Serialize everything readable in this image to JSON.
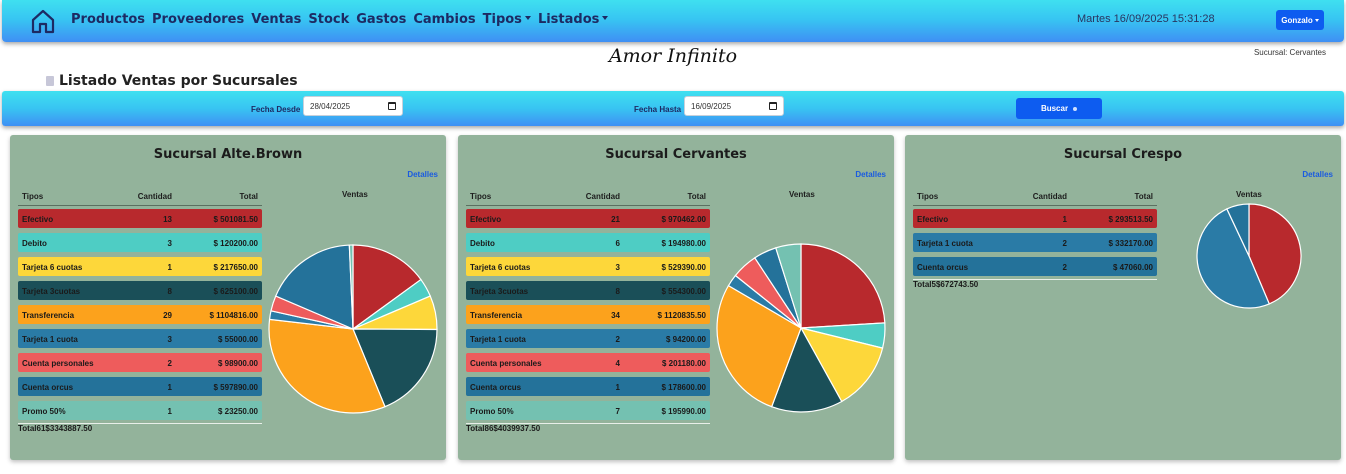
{
  "navbar": {
    "menu": [
      {
        "label": "Productos",
        "dropdown": false
      },
      {
        "label": "Proveedores",
        "dropdown": false
      },
      {
        "label": "Ventas",
        "dropdown": false
      },
      {
        "label": "Stock",
        "dropdown": false
      },
      {
        "label": "Gastos",
        "dropdown": false
      },
      {
        "label": "Cambios",
        "dropdown": false
      },
      {
        "label": "Tipos",
        "dropdown": true
      },
      {
        "label": "Listados",
        "dropdown": true
      }
    ],
    "datetime": "Martes 16/09/2025 15:31:28",
    "user": "Gonzalo",
    "icon": "home-icon"
  },
  "brand": "Amor Infinito",
  "branch_label": "Sucursal: Cervantes",
  "page_title": "Listado Ventas por Sucursales",
  "filters": {
    "desde_label": "Fecha Desde",
    "desde_value": "28/04/2025",
    "hasta_label": "Fecha Hasta",
    "hasta_value": "16/09/2025",
    "search_label": "Buscar"
  },
  "colors": {
    "Efectivo": "#b8292d",
    "Debito": "#4ecdc4",
    "Tarjeta 6 cuotas": "#fdd73a",
    "Tarjeta 3cuotas": "#1a4f58",
    "Transferencia": "#fca21c",
    "Tarjeta 1 cuota": "#2a7ba6",
    "Cuenta personales": "#ee5c5c",
    "Cuenta orcus": "#24729a",
    "Promo 50%": "#74c1b1"
  },
  "branches": [
    {
      "title": "Sucursal Alte.Brown",
      "details_label": "Detalles",
      "headers": {
        "tipo": "Tipos",
        "cantidad": "Cantidad",
        "total": "Total"
      },
      "chart_title": "Ventas",
      "rows": [
        {
          "tipo": "Efectivo",
          "cantidad": "13",
          "total": "$ 501081.50"
        },
        {
          "tipo": "Debito",
          "cantidad": "3",
          "total": "$ 120200.00"
        },
        {
          "tipo": "Tarjeta 6 cuotas",
          "cantidad": "1",
          "total": "$ 217650.00"
        },
        {
          "tipo": "Tarjeta 3cuotas",
          "cantidad": "8",
          "total": "$ 625100.00"
        },
        {
          "tipo": "Transferencia",
          "cantidad": "29",
          "total": "$ 1104816.00"
        },
        {
          "tipo": "Tarjeta 1 cuota",
          "cantidad": "3",
          "total": "$ 55000.00"
        },
        {
          "tipo": "Cuenta personales",
          "cantidad": "2",
          "total": "$ 98900.00"
        },
        {
          "tipo": "Cuenta orcus",
          "cantidad": "1",
          "total": "$ 597890.00"
        },
        {
          "tipo": "Promo 50%",
          "cantidad": "1",
          "total": "$ 23250.00"
        }
      ],
      "total": {
        "label": "Total",
        "cantidad": "61",
        "total": "$3343887.50"
      }
    },
    {
      "title": "Sucursal Cervantes",
      "details_label": "Detalles",
      "headers": {
        "tipo": "Tipos",
        "cantidad": "Cantidad",
        "total": "Total"
      },
      "chart_title": "Ventas",
      "rows": [
        {
          "tipo": "Efectivo",
          "cantidad": "21",
          "total": "$ 970462.00"
        },
        {
          "tipo": "Debito",
          "cantidad": "6",
          "total": "$ 194980.00"
        },
        {
          "tipo": "Tarjeta 6 cuotas",
          "cantidad": "3",
          "total": "$ 529390.00"
        },
        {
          "tipo": "Tarjeta 3cuotas",
          "cantidad": "8",
          "total": "$ 554300.00"
        },
        {
          "tipo": "Transferencia",
          "cantidad": "34",
          "total": "$ 1120835.50"
        },
        {
          "tipo": "Tarjeta 1 cuota",
          "cantidad": "2",
          "total": "$ 94200.00"
        },
        {
          "tipo": "Cuenta personales",
          "cantidad": "4",
          "total": "$ 201180.00"
        },
        {
          "tipo": "Cuenta orcus",
          "cantidad": "1",
          "total": "$ 178600.00"
        },
        {
          "tipo": "Promo 50%",
          "cantidad": "7",
          "total": "$ 195990.00"
        }
      ],
      "total": {
        "label": "Total",
        "cantidad": "86",
        "total": "$4039937.50"
      }
    },
    {
      "title": "Sucursal Crespo",
      "details_label": "Detalles",
      "headers": {
        "tipo": "Tipos",
        "cantidad": "Cantidad",
        "total": "Total"
      },
      "chart_title": "Ventas",
      "rows": [
        {
          "tipo": "Efectivo",
          "cantidad": "1",
          "total": "$ 293513.50"
        },
        {
          "tipo": "Tarjeta 1 cuota",
          "cantidad": "2",
          "total": "$ 332170.00"
        },
        {
          "tipo": "Cuenta orcus",
          "cantidad": "2",
          "total": "$ 47060.00"
        }
      ],
      "total": {
        "label": "Total",
        "cantidad": "5",
        "total": "$672743.50"
      }
    }
  ]
}
